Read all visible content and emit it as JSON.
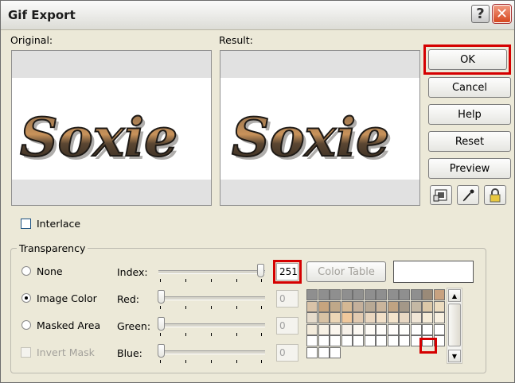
{
  "window": {
    "title": "Gif Export",
    "help_glyph": "?",
    "close_glyph": "✕"
  },
  "preview": {
    "original_label": "Original:",
    "result_label": "Result:",
    "image_text": "Soxie"
  },
  "buttons": {
    "ok": "OK",
    "cancel": "Cancel",
    "help": "Help",
    "reset": "Reset",
    "preview": "Preview"
  },
  "icon_buttons": [
    "proof-icon",
    "eyedropper-icon",
    "lock-icon"
  ],
  "interlace": {
    "label": "Interlace",
    "checked": false
  },
  "transparency": {
    "group_label": "Transparency",
    "options": [
      {
        "label": "None",
        "selected": false
      },
      {
        "label": "Image Color",
        "selected": true
      },
      {
        "label": "Masked Area",
        "selected": false
      }
    ],
    "invert_mask_label": "Invert Mask",
    "index_label": "Index:",
    "index_value": "251",
    "red_label": "Red:",
    "red_value": "0",
    "green_label": "Green:",
    "green_value": "0",
    "blue_label": "Blue:",
    "blue_value": "0",
    "color_table_label": "Color Table"
  },
  "colors": {
    "highlight": "#d50000",
    "palette_rows": [
      [
        "#8f8f8f",
        "#8f8f8f",
        "#8f8f8f",
        "#8f8f8f",
        "#8f8f8f",
        "#8f8f8f",
        "#8f8f8f",
        "#8f8f8f",
        "#8f8f8f",
        "#8f8f8f",
        "#9a8a78",
        "#c8a280"
      ],
      [
        "#d9c3a8",
        "#c6a47e",
        "#bfa889",
        "#d4b894",
        "#c4b09b",
        "#b8a995",
        "#cab59c",
        "#c0a382",
        "#a49888",
        "#c4b8a4",
        "#dcc8a8",
        "#ecdcc0"
      ],
      [
        "#e6dccc",
        "#d8c2a4",
        "#ecd6b6",
        "#f0c89c",
        "#e2cab0",
        "#ead7c0",
        "#f2e0c8",
        "#f4e4cc",
        "#e8d8c4",
        "#f0e6d6",
        "#f6ecd8",
        "#f8f0e0"
      ],
      [
        "#f4ecdc",
        "#f8f2e6",
        "#fbf6ee",
        "#f6f0e8",
        "#fcf8f2",
        "#fefbf6",
        "#fefcf9",
        "#fffdfb",
        "#fefefc",
        "#fefefd",
        "#ffffff",
        "#ffffff"
      ],
      [
        "#ffffff",
        "#ffffff",
        "#ffffff",
        "#ffffff",
        "#ffffff",
        "#ffffff",
        "#ffffff",
        "#ffffff",
        "#ffffff",
        "#ffffff",
        "#ffffff",
        "#ffffff"
      ],
      [
        "#ffffff",
        "#ffffff",
        "#ffffff"
      ]
    ]
  }
}
